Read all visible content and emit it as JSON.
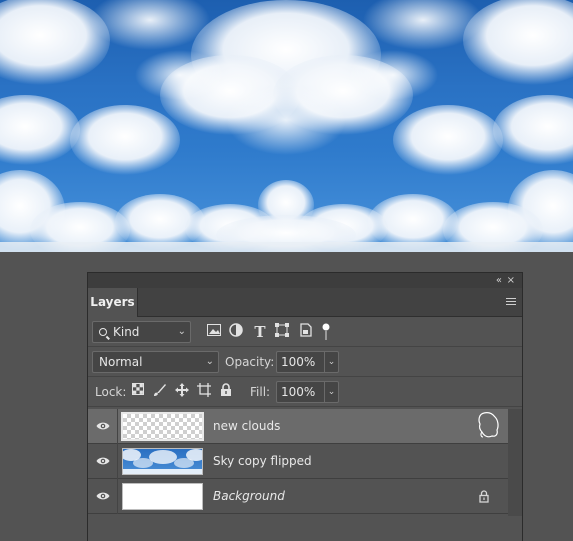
{
  "canvas": {
    "sky_colors": {
      "deep": "#1d5fb0",
      "mid": "#2f7bcc",
      "light": "#4a92d8",
      "cloud": "#ffffff"
    }
  },
  "panel": {
    "tab_label": "Layers",
    "collapse_glyph": "«",
    "close_glyph": "×",
    "filter": {
      "kind_label": "Kind",
      "icons": [
        "image-filter-icon",
        "adjustment-filter-icon",
        "type-filter-icon",
        "shape-filter-icon",
        "smart-object-filter-icon",
        "filter-toggle-icon"
      ]
    },
    "blend": {
      "mode": "Normal",
      "opacity_label": "Opacity:",
      "opacity_value": "100%"
    },
    "lock": {
      "label": "Lock:",
      "icons": [
        "lock-transparent-icon",
        "lock-image-icon",
        "lock-position-icon",
        "lock-artboard-icon",
        "lock-all-icon"
      ],
      "fill_label": "Fill:",
      "fill_value": "100%"
    },
    "layers": [
      {
        "name": "new clouds",
        "selected": true,
        "thumbnail": "transparent",
        "italic": false
      },
      {
        "name": "Sky copy flipped",
        "selected": false,
        "thumbnail": "sky",
        "italic": false
      },
      {
        "name": "Background",
        "selected": false,
        "thumbnail": "white",
        "italic": true,
        "locked": true
      }
    ]
  },
  "colors": {
    "panel_bg": "#535353",
    "selected_row": "#6b6b6b",
    "text": "#e8e8e8"
  }
}
